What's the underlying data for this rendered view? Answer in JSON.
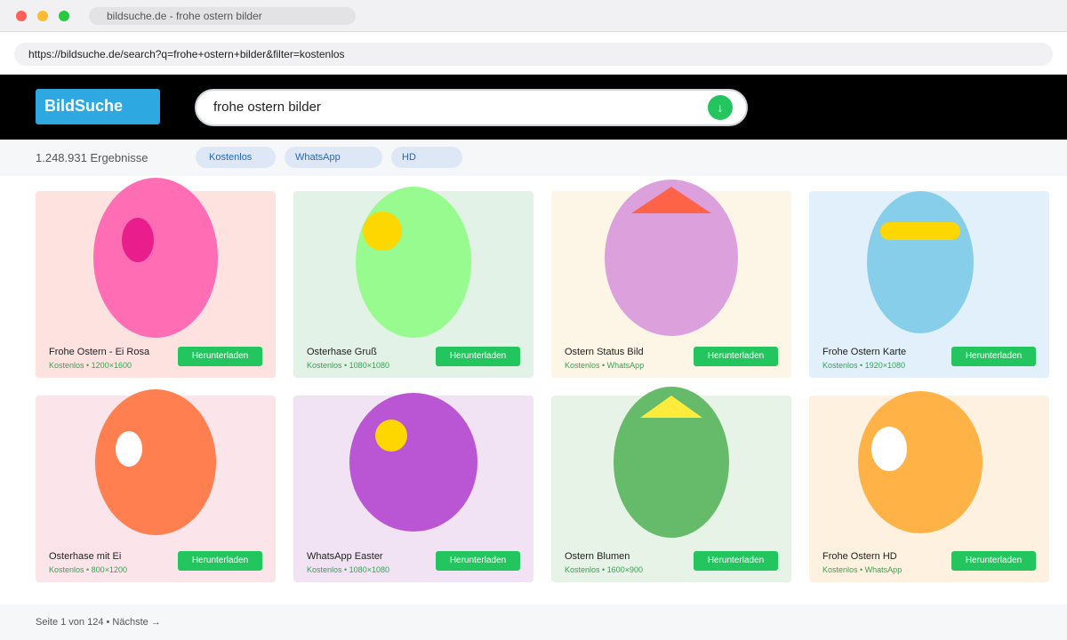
{
  "browser": {
    "tab_title": "bildsuche.de - frohe ostern bilder",
    "url": "https://bildsuche.de/search?q=frohe+ostern+bilder&filter=kostenlos"
  },
  "header": {
    "logo": "BildSuche",
    "search_value": "frohe ostern bilder",
    "search_button_icon": "↓"
  },
  "filters": {
    "result_count": "1.248.931 Ergebnisse",
    "chips": [
      "Kostenlos",
      "WhatsApp",
      "HD"
    ]
  },
  "results": [
    {
      "title": "Frohe Ostern - Ei Rosa",
      "meta": "Kostenlos • 1200×1600",
      "button": "Herunterladen",
      "bg": "#fde2e0",
      "egg_color": "#ff6eb4",
      "deco_color": "#e91e8c"
    },
    {
      "title": "Osterhase Gruß",
      "meta": "Kostenlos • 1080×1080",
      "button": "Herunterladen",
      "bg": "#e3f2e6",
      "egg_color": "#98fb8f",
      "deco_color": "#ffd700"
    },
    {
      "title": "Ostern Status Bild",
      "meta": "Kostenlos • WhatsApp",
      "button": "Herunterladen",
      "bg": "#fdf6e6",
      "egg_color": "#dca0dc",
      "deco_color": "#ff6347"
    },
    {
      "title": "Frohe Ostern Karte",
      "meta": "Kostenlos • 1920×1080",
      "button": "Herunterladen",
      "bg": "#e1f0fb",
      "egg_color": "#87ceeb",
      "deco_color": "#ffd700"
    },
    {
      "title": "Osterhase mit Ei",
      "meta": "Kostenlos • 800×1200",
      "button": "Herunterladen",
      "bg": "#fbe4ea",
      "egg_color": "#ff7f50",
      "deco_color": "#ffffff"
    },
    {
      "title": "WhatsApp Easter",
      "meta": "Kostenlos • 1080×1080",
      "button": "Herunterladen",
      "bg": "#f1e3f4",
      "egg_color": "#ba55d3",
      "deco_color": "#ffd700"
    },
    {
      "title": "Ostern Blumen",
      "meta": "Kostenlos • 1600×900",
      "button": "Herunterladen",
      "bg": "#e6f3e6",
      "egg_color": "#66bb6a",
      "deco_color": "#ffeb3b"
    },
    {
      "title": "Frohe Ostern HD",
      "meta": "Kostenlos • WhatsApp",
      "button": "Herunterladen",
      "bg": "#fef1df",
      "egg_color": "#ffb347",
      "deco_color": "#ffffff"
    }
  ],
  "footer": {
    "pagination": "Seite 1 von 124 • Nächste →"
  }
}
